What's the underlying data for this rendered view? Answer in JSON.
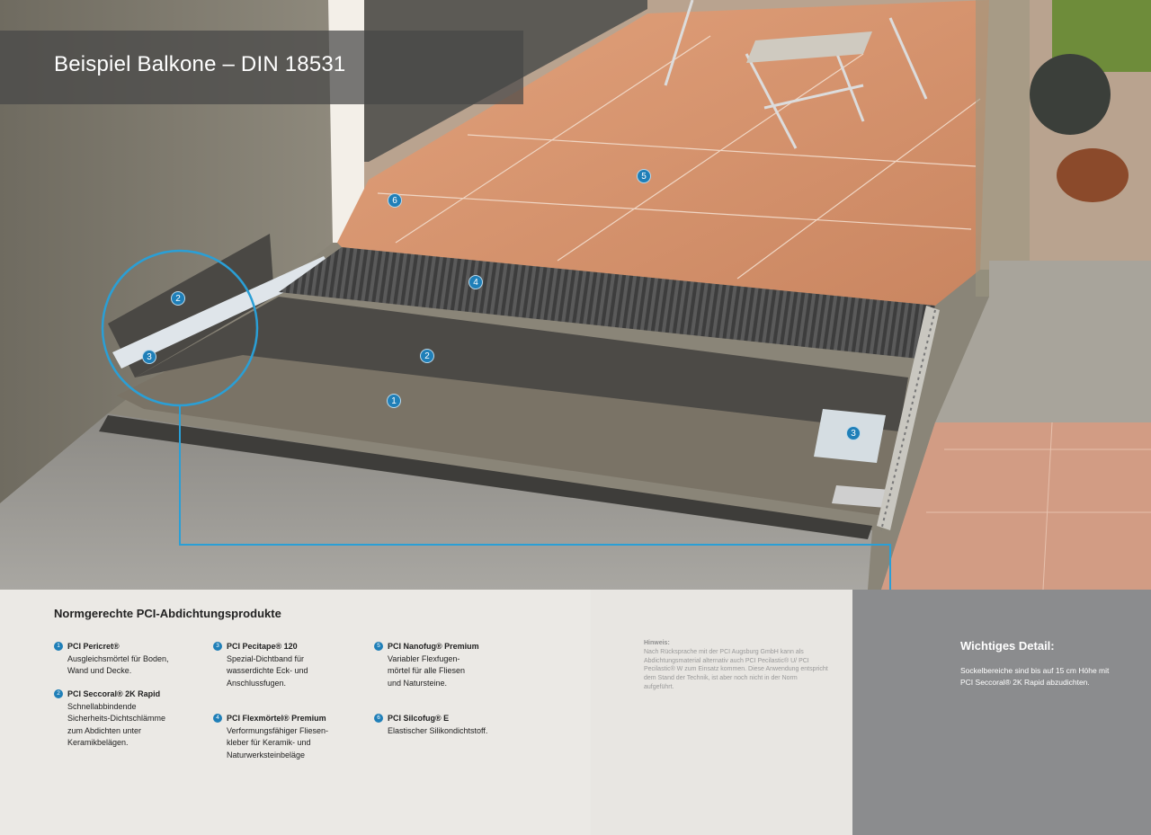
{
  "header": {
    "title": "Beispiel Balkone – DIN 18531"
  },
  "markers": [
    "1",
    "2",
    "2",
    "3",
    "3",
    "4",
    "5",
    "6"
  ],
  "products": {
    "section_title": "Normgerechte PCI-Abdichtungsprodukte",
    "items": [
      {
        "num": "1",
        "name": "PCI Pericret®",
        "desc": "Ausgleichsmörtel für Boden,\nWand und Decke."
      },
      {
        "num": "2",
        "name": "PCI Seccoral® 2K Rapid",
        "desc": "Schnellabbindende\nSicherheits-Dichtschlämme\nzum Abdichten unter\nKeramikbelägen."
      },
      {
        "num": "3",
        "name": "PCI Pecitape® 120",
        "desc": "Spezial-Dichtband für\nwasserdichte Eck- und\nAnschlussfugen."
      },
      {
        "num": "4",
        "name": "PCI Flexmörtel® Premium",
        "desc": "Verformungsfähiger Fliesen-\nkleber für Keramik- und\nNaturwerksteinbeläge"
      },
      {
        "num": "5",
        "name": "PCI Nanofug® Premium",
        "desc": "Variabler Flexfugen-\nmörtel für alle Fliesen\nund Natursteine."
      },
      {
        "num": "6",
        "name": "PCI Silcofug® E",
        "desc": "Elastischer Silikondichtstoff."
      }
    ]
  },
  "hint": {
    "title": "Hinweis:",
    "text": "Nach Rücksprache mit der PCI Augsburg GmbH kann als Abdichtungsmaterial alternativ auch PCI Pecilastic® U/ PCI Pecilastic® W zum Einsatz kommen. Diese Anwendung entspricht dem Stand der Technik, ist aber noch nicht in der Norm aufgeführt."
  },
  "important": {
    "title": "Wichtiges Detail:",
    "text": "Sockelbereiche sind bis auf 15 cm Höhe mit PCI Seccoral® 2K Rapid abzudichten."
  },
  "colors": {
    "accent": "#1f7fb8",
    "dark_panel": "#8b8c8e"
  }
}
